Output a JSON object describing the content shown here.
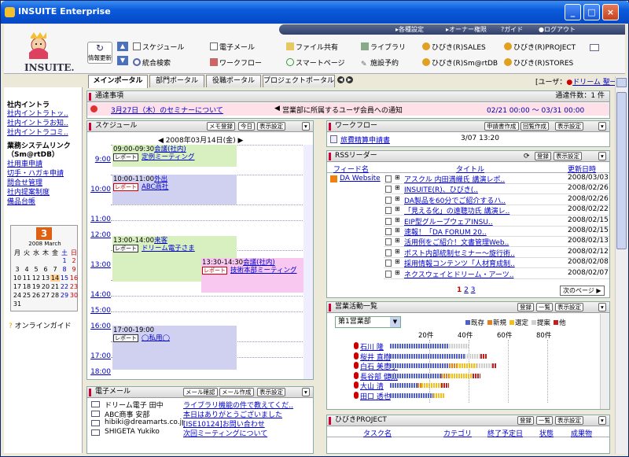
{
  "window": {
    "title": "INSUITE Enterprise",
    "buttons": [
      "_",
      "□",
      "×"
    ]
  },
  "topbar": {
    "items": [
      "各種設定",
      "オーナー権限",
      "ガイド",
      "ログアウト"
    ]
  },
  "logo": {
    "text": "INSUITE."
  },
  "refresh": {
    "label": "情報更新"
  },
  "nav": {
    "row1": [
      "スケジュール",
      "電子メール",
      "ファイル共有",
      "ライブラリ",
      "ひびき(R)SALES",
      "ひびき(R)PROJECT"
    ],
    "row2": [
      "統合検索",
      "ワークフロー",
      "スマートページ",
      "施設予約",
      "ひびき(R)Sm@rtDB",
      "ひびき(R)STORES"
    ]
  },
  "tabs": [
    "メインポータル",
    "部門ポータル",
    "役職ポータル",
    "プロジェクトポータル"
  ],
  "user": {
    "label": "[ユーザ：",
    "name": "ドリーム 聖一"
  },
  "left": {
    "group1": {
      "title": "社内イントラ",
      "links": [
        "社内イントラトッ..",
        "社内イントラお知..",
        "社内イントラコミ.."
      ]
    },
    "group2": {
      "title": "業務システムリンク（Sm@rtDB）",
      "links": [
        "社用車申請",
        "切手・ハガキ申請",
        "問合せ管理",
        "社内提案制度",
        "備品台帳"
      ]
    },
    "calendar": {
      "day": "3",
      "month": "2008 March",
      "weekdays": [
        "月",
        "火",
        "水",
        "木",
        "金",
        "土",
        "日"
      ],
      "weeks": [
        [
          "",
          "",
          "",
          "",
          "",
          "1",
          "2"
        ],
        [
          "3",
          "4",
          "5",
          "6",
          "7",
          "8",
          "9"
        ],
        [
          "10",
          "11",
          "12",
          "13",
          "14",
          "15",
          "16"
        ],
        [
          "17",
          "18",
          "19",
          "20",
          "21",
          "22",
          "23"
        ],
        [
          "24",
          "25",
          "26",
          "27",
          "28",
          "29",
          "30"
        ],
        [
          "31",
          "",
          "",
          "",
          "",
          "",
          ""
        ]
      ]
    },
    "guide": "オンラインガイド"
  },
  "notice": {
    "title": "通達事項",
    "count": "通達件数：1 件",
    "date_link": "3月27日（木）のセミナーについて",
    "message": "営業部に所属するユーザ会員への通知",
    "period": "02/21 00:00 〜 03/31 00:00"
  },
  "schedule": {
    "title": "スケジュール",
    "buttons": [
      "メモ登録",
      "今日",
      "表示設定"
    ],
    "date": "2008年03月14日(金)",
    "hours": [
      "9:00",
      "10:00",
      "11:00",
      "12:00",
      "13:00",
      "14:00",
      "15:00",
      "16:00",
      "17:00",
      "18:00"
    ],
    "events": [
      {
        "time": "09:00-09:30",
        "title": "会議(社内)",
        "sub": "定例ミーティング"
      },
      {
        "time": "10:00-11:00",
        "title": "外出",
        "sub": "ABC商社"
      },
      {
        "time": "13:00-14:00",
        "title": "来客",
        "sub": "ドリーム電子さま"
      },
      {
        "time": "13:30-14:30",
        "title": "会議(社内)",
        "sub": "技術本部ミーティング"
      },
      {
        "time": "17:00-19:00",
        "title": "",
        "sub": "◯私用◯"
      }
    ],
    "report": "レポート"
  },
  "workflow": {
    "title": "ワークフロー",
    "buttons": [
      "申請書作成",
      "回覧作成",
      "表示設定"
    ],
    "item": "旅費精算申請書",
    "date": "3/07 13:20"
  },
  "rss": {
    "title": "RSSリーダー",
    "buttons": [
      "登録",
      "表示設定"
    ],
    "cols": [
      "フィード名",
      "タイトル",
      "更新日時"
    ],
    "feed": "DA Website",
    "items": [
      [
        "アスクル 内田満織氏 講演レポ..",
        "2008/03/03"
      ],
      [
        "INSUITE(R)、ひびき(..",
        "2008/02/26"
      ],
      [
        "DA製品を60分でご紹介するハ..",
        "2008/02/26"
      ],
      [
        "「見える化」の遠聴功氏 講演レ..",
        "2008/02/22"
      ],
      [
        "EIP型グループウェアINSU..",
        "2008/02/15"
      ],
      [
        "速報！「DA FORUM 20..",
        "2008/02/15"
      ],
      [
        "活用例をご紹介！文書管理Web..",
        "2008/02/13"
      ],
      [
        "ポスト内部統制セミナー〜旋行術..",
        "2008/02/12"
      ],
      [
        "採用情報コンテンツ「人材育成制..",
        "2008/02/08"
      ],
      [
        "ネクスウェイとドリーム・アーツ..",
        "2008/02/07"
      ]
    ],
    "pages": [
      "1",
      "2",
      "3"
    ],
    "next": "次のページ"
  },
  "sales": {
    "title": "営業活動一覧",
    "buttons": [
      "登録",
      "一覧",
      "表示設定"
    ],
    "select": "第1営業部",
    "legend": [
      "既存",
      "新規",
      "選定",
      "提案",
      "他"
    ],
    "ticks": [
      "20件",
      "40件",
      "60件",
      "80件"
    ],
    "people": [
      {
        "name": "石川 隆",
        "v": [
          30,
          0,
          0,
          10,
          0
        ]
      },
      {
        "name": "桜井 直樹",
        "v": [
          38,
          0,
          0,
          8,
          3
        ]
      },
      {
        "name": "白石 美恵子",
        "v": [
          30,
          4,
          10,
          8,
          2
        ]
      },
      {
        "name": "長谷部 健太",
        "v": [
          26,
          4,
          12,
          0,
          4
        ]
      },
      {
        "name": "大山 清",
        "v": [
          14,
          2,
          10,
          0,
          4
        ]
      },
      {
        "name": "田口 透也",
        "v": [
          22,
          0,
          6,
          0,
          0
        ]
      }
    ]
  },
  "mail": {
    "title": "電子メール",
    "buttons": [
      "メール確認",
      "メール作成",
      "表示設定"
    ],
    "items": [
      [
        "ドリーム電子 田中",
        "ライブラリ機能の件で教えてくだ.."
      ],
      [
        "ABC商事 安部",
        "本日はありがとうございました"
      ],
      [
        "hibiki@dreamarts.co.jp",
        "[ISE10124]お問い合わせ"
      ],
      [
        "SHIGETA Yukiko",
        "次回ミーティングについて"
      ]
    ]
  },
  "project": {
    "title": "ひびきPROJECT",
    "buttons": [
      "登録",
      "一覧",
      "表示設定"
    ],
    "cols": [
      "タスク名",
      "カテゴリ",
      "終了予定日",
      "状態",
      "成果物"
    ]
  },
  "colors": {
    "existing": "#5060c8",
    "new": "#e08020",
    "select": "#f0c020",
    "proposal": "#d0d0d0",
    "other": "#c02020"
  }
}
